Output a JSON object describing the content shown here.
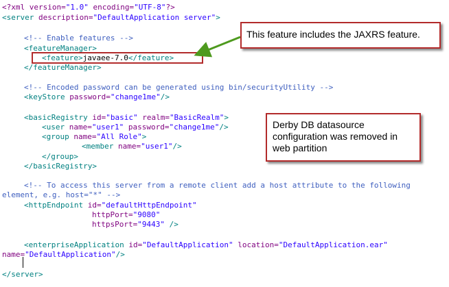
{
  "code": {
    "decl": {
      "open": "<?xml ",
      "version_attr": "version=",
      "version_val": "\"1.0\"",
      "encoding_attr": " encoding=",
      "encoding_val": "\"UTF-8\"",
      "close": "?>"
    },
    "server_open": {
      "tag": "<server",
      "attr": " description=",
      "val": "\"DefaultApplication server\"",
      "close": ">"
    },
    "comment_enable": "<!-- Enable features -->",
    "feature_manager_open": "<featureManager>",
    "feature": {
      "open": "<feature>",
      "text": "javaee-7.0",
      "close": "</feature>"
    },
    "feature_manager_close": "</featureManager>",
    "comment_password": "<!-- Encoded password can be generated using bin/securityUtility -->",
    "keystore": {
      "tag": "<keyStore",
      "attr": " password=",
      "val": "\"change1me\"",
      "close": "/>"
    },
    "basic_registry_open": {
      "tag": "<basicRegistry",
      "attr1": " id=",
      "val1": "\"basic\"",
      "attr2": " realm=",
      "val2": "\"BasicRealm\"",
      "close": ">"
    },
    "user": {
      "tag": "<user",
      "attr1": " name=",
      "val1": "\"user1\"",
      "attr2": " password=",
      "val2": "\"change1me\"",
      "close": "/>"
    },
    "group_open": {
      "tag": "<group",
      "attr": " name=",
      "val": "\"All Role\"",
      "close": ">"
    },
    "member": {
      "tag": "<member",
      "attr": " name=",
      "val": "\"user1\"",
      "close": "/>"
    },
    "group_close": "</group>",
    "basic_registry_close": "</basicRegistry>",
    "comment_remote_1": "<!-- To access this server from a remote client add a host attribute to the following",
    "comment_remote_2": "element, e.g. host=\"*\" -->",
    "http_endpoint_1": {
      "tag": "<httpEndpoint",
      "attr": " id=",
      "val": "\"defaultHttpEndpoint\""
    },
    "http_endpoint_2": {
      "attr": "httpPort=",
      "val": "\"9080\""
    },
    "http_endpoint_3": {
      "attr": "httpsPort=",
      "val": "\"9443\"",
      "close": " />"
    },
    "enterprise_app_1": {
      "tag": "<enterpriseApplication",
      "attr1": " id=",
      "val1": "\"DefaultApplication\"",
      "attr2": " location=",
      "val2": "\"DefaultApplication.ear\""
    },
    "enterprise_app_2": {
      "attr": "name=",
      "val": "\"DefaultApplication\"",
      "close": "/>"
    },
    "server_close": "</server>"
  },
  "callouts": {
    "feature_note": "This feature includes the JAXRS feature.",
    "derby_note_1": "Derby DB datasource",
    "derby_note_2": "configuration was removed in",
    "derby_note_3": "web partition"
  },
  "colors": {
    "highlight": "#b22a2a",
    "arrow": "#4e9a1e"
  }
}
